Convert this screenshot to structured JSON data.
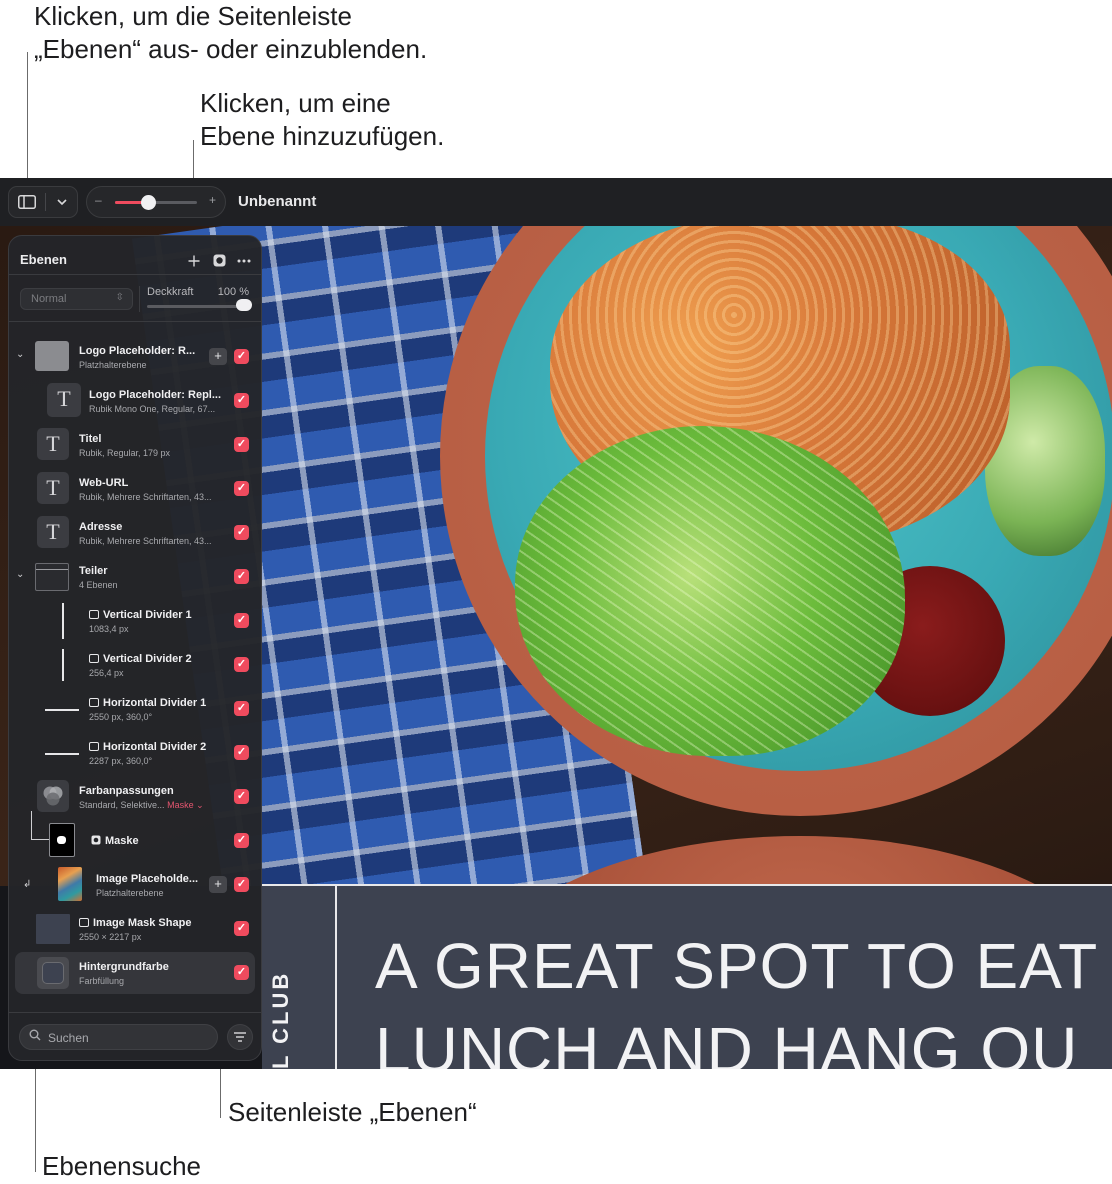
{
  "callouts": {
    "sidebar_toggle": "Klicken, um die Seitenleiste\n„Ebenen“ aus- oder einzublenden.",
    "add_layer": "Klicken, um eine\nEbene hinzuzufügen.",
    "layers_sidebar": "Seitenleiste „Ebenen“",
    "layer_search": "Ebenensuche"
  },
  "toolbar": {
    "document_title": "Unbenannt",
    "zoom_minus": "–",
    "zoom_plus": "+",
    "zoom_level": 0.4
  },
  "sidebar": {
    "title": "Ebenen",
    "add_icon": "plus-icon",
    "mask_icon": "mask-icon",
    "more_icon": "ellipsis-icon",
    "blend_mode": "Normal",
    "opacity_label": "Deckkraft",
    "opacity_value": "100 %",
    "search_placeholder": "Suchen",
    "accent_color": "#ef4b5e",
    "layers": [
      {
        "name": "Logo Placeholder: R...",
        "sub": "Platzhalterebene"
      },
      {
        "name": "Logo Placeholder: Repl...",
        "sub": "Rubik Mono One, Regular, 67..."
      },
      {
        "name": "Titel",
        "sub": "Rubik, Regular, 179 px"
      },
      {
        "name": "Web-URL",
        "sub": "Rubik, Mehrere Schriftarten, 43..."
      },
      {
        "name": "Adresse",
        "sub": "Rubik, Mehrere Schriftarten, 43..."
      },
      {
        "name": "Teiler",
        "sub": "4 Ebenen"
      },
      {
        "name": "Vertical Divider 1",
        "sub": "1083,4 px"
      },
      {
        "name": "Vertical Divider 2",
        "sub": "256,4 px"
      },
      {
        "name": "Horizontal Divider 1",
        "sub": "2550 px, 360,0°"
      },
      {
        "name": "Horizontal Divider 2",
        "sub": "2287 px, 360,0°"
      },
      {
        "name": "Farbanpassungen",
        "sub": "Standard, Selektive...",
        "sub_link": "Maske"
      },
      {
        "name": "Maske",
        "sub": ""
      },
      {
        "name": "Image Placeholde...",
        "sub": "Platzhalterebene"
      },
      {
        "name": "Image Mask Shape",
        "sub": "2550 × 2217 px"
      },
      {
        "name": "Hintergrundfarbe",
        "sub": "Farbfüllung"
      }
    ]
  },
  "poster": {
    "headline": "A GREAT SPOT TO EAT\nLUNCH AND HANG OU",
    "vertical_text": "L CLUB"
  }
}
